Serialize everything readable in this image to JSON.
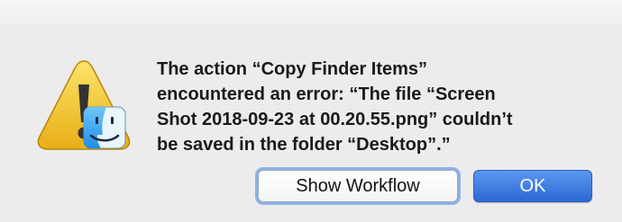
{
  "dialog": {
    "message": "The action “Copy Finder Items”\nencountered an error: “The file “Screen\nShot 2018-09-23 at 00.20.55.png” couldn’t\nbe saved in the folder “Desktop”.”",
    "icons": {
      "alert": "warning-triangle-icon",
      "badge": "finder-face-icon"
    },
    "buttons": {
      "show_workflow": "Show Workflow",
      "ok": "OK"
    },
    "colors": {
      "background": "#ececec",
      "primary_button": "#2f6fdc",
      "focus_ring": "#8db1e6",
      "warning_yellow": "#f2c531"
    }
  }
}
